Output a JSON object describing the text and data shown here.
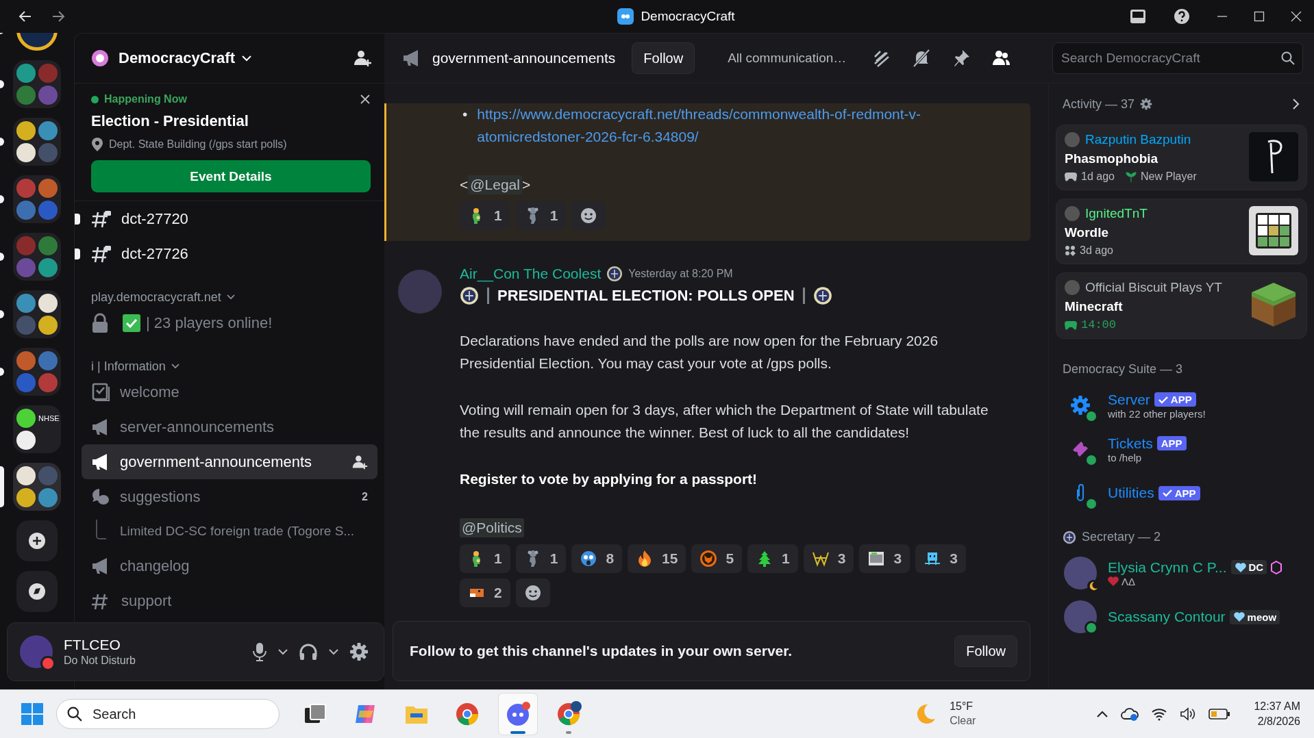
{
  "window": {
    "title": "DemocracyCraft"
  },
  "server_rail": [
    {
      "kind": "server",
      "unread": true,
      "selected": false
    },
    {
      "kind": "folder",
      "unread": true,
      "selected": false
    },
    {
      "kind": "folder",
      "unread": true,
      "selected": false
    },
    {
      "kind": "folder",
      "unread": true,
      "selected": false
    },
    {
      "kind": "folder",
      "unread": true,
      "selected": false
    },
    {
      "kind": "folder",
      "unread": true,
      "selected": false
    },
    {
      "kind": "folder",
      "unread": true,
      "selected": false
    },
    {
      "kind": "folder",
      "label": "NHSE",
      "unread": false,
      "selected": false
    },
    {
      "kind": "folder",
      "unread": false,
      "selected": true
    },
    {
      "kind": "add"
    },
    {
      "kind": "discover"
    }
  ],
  "sidebar": {
    "server_name": "DemocracyCraft",
    "event": {
      "status": "Happening Now",
      "title": "Election - Presidential",
      "location": "Dept. State Building (/gps start polls)",
      "button": "Event Details"
    },
    "items": [
      {
        "kind": "private-text",
        "name": "dct-27720",
        "unread": true,
        "selected": false
      },
      {
        "kind": "private-text",
        "name": "dct-27726",
        "unread": true,
        "selected": false
      },
      {
        "kind": "category",
        "name": "play.democracycraft.net"
      },
      {
        "kind": "locked-voice",
        "name": "| 23 players online!",
        "unread": false,
        "selected": false
      },
      {
        "kind": "category",
        "name": "i | Information"
      },
      {
        "kind": "rules",
        "name": "welcome",
        "unread": false,
        "selected": false
      },
      {
        "kind": "announcement",
        "name": "server-announcements",
        "unread": false,
        "selected": false
      },
      {
        "kind": "announcement",
        "name": "government-announcements",
        "unread": false,
        "selected": true
      },
      {
        "kind": "forum",
        "name": "suggestions",
        "badge": "2",
        "unread": false,
        "selected": false
      },
      {
        "kind": "thread",
        "name": "Limited DC-SC foreign trade (Togore S...",
        "unread": false,
        "selected": false
      },
      {
        "kind": "announcement",
        "name": "changelog",
        "unread": false,
        "selected": false
      },
      {
        "kind": "text",
        "name": "support",
        "unread": false,
        "selected": false
      }
    ],
    "user": {
      "name": "FTLCEO",
      "status": "Do Not Disturb"
    }
  },
  "header": {
    "channel": "government-announcements",
    "follow": "Follow",
    "notice": "All communication…",
    "tools": [
      {
        "kind": "threads",
        "selected": false
      },
      {
        "kind": "muted-bell",
        "selected": false
      },
      {
        "kind": "pin",
        "selected": false
      },
      {
        "kind": "members",
        "selected": true
      }
    ],
    "search": {
      "placeholder": "Search DemocracyCraft"
    }
  },
  "messages": [
    {
      "highlighted": true,
      "blocks": [
        {
          "kind": "link-list",
          "bullet": "•",
          "items": [
            "https://www.democracycraft.net/threads/commonwealth-of-redmont-v-atomicredstoner-2026-fcr-6.34809/"
          ]
        },
        {
          "kind": "mention-line",
          "before": "<",
          "mention": "@Legal",
          "after": ">"
        }
      ],
      "reactions": [
        {
          "kind": "person",
          "count": "1"
        },
        {
          "kind": "koala",
          "count": "1"
        }
      ]
    },
    {
      "highlighted": false,
      "author": "Air__Con The Coolest",
      "time": "Yesterday at 8:20 PM",
      "blocks": [
        {
          "kind": "heading",
          "text": "PRESIDENTIAL ELECTION: POLLS OPEN"
        },
        {
          "kind": "paragraph",
          "text": "Declarations have ended and the polls are now open for the February 2026 Presidential Election. You may cast your vote at /gps polls."
        },
        {
          "kind": "paragraph",
          "text": "Voting will remain open for 3 days, after which the Department of State will tabulate the results and announce the winner. Best of luck to all the candidates!"
        },
        {
          "kind": "bold-paragraph",
          "text": "Register to vote by applying for a passport!"
        },
        {
          "kind": "mention-line",
          "mention": "@Politics"
        }
      ],
      "reactions": [
        {
          "kind": "person",
          "count": "1"
        },
        {
          "kind": "koala",
          "count": "1"
        },
        {
          "kind": "fearful",
          "count": "8"
        },
        {
          "kind": "fire",
          "count": "15"
        },
        {
          "kind": "fox-badge",
          "count": "5"
        },
        {
          "kind": "tree",
          "count": "1"
        },
        {
          "kind": "crown",
          "count": "3"
        },
        {
          "kind": "wolf",
          "count": "3"
        },
        {
          "kind": "robot",
          "count": "3"
        },
        {
          "kind": "fox",
          "count": "2"
        }
      ]
    }
  ],
  "follow_banner": {
    "text": "Follow to get this channel's updates in your own server.",
    "button": "Follow"
  },
  "member_list": {
    "activity_header": "Activity — 37",
    "activities": [
      {
        "user": "Razputin Bazputin",
        "color": "#00a8fc",
        "game": "Phasmophobia",
        "thumb": {
          "kind": "phasmophobia"
        },
        "meta": [
          {
            "kind": "controller",
            "text": "1d ago"
          },
          {
            "kind": "sprout",
            "text": "New Player"
          }
        ]
      },
      {
        "user": "IgnitedTnT",
        "color": "#57f287",
        "game": "Wordle",
        "thumb": {
          "kind": "wordle"
        },
        "meta": [
          {
            "kind": "apps",
            "text": "3d ago"
          }
        ]
      },
      {
        "user": "Official Biscuit Plays YT",
        "color": "#b5bac1",
        "game": "Minecraft",
        "thumb": {
          "kind": "minecraft"
        },
        "meta": [
          {
            "kind": "timer",
            "text": "14:00"
          }
        ]
      }
    ],
    "groups": [
      {
        "title": "Democracy Suite — 3",
        "role_icon": false,
        "members": [
          {
            "name": "Server",
            "avatar": {
              "kind": "gear"
            },
            "presence": {
              "kind": "online"
            },
            "tag": {
              "kind": "app",
              "text": "APP",
              "verified": true
            },
            "subtitle": "with 22 other players!"
          },
          {
            "name": "Tickets",
            "avatar": {
              "kind": "ticket"
            },
            "presence": {
              "kind": "online"
            },
            "tag": {
              "kind": "app",
              "text": "APP",
              "verified": false
            },
            "subtitle": "to /help"
          },
          {
            "name": "Utilities",
            "avatar": {
              "kind": "clip"
            },
            "presence": {
              "kind": "online"
            },
            "tag": {
              "kind": "app",
              "text": "APP",
              "verified": true
            }
          }
        ]
      },
      {
        "title": "Secretary — 2",
        "role_icon": true,
        "members": [
          {
            "name": "Elysia Crynn C P...",
            "avatar": {
              "kind": "photo"
            },
            "presence": {
              "kind": "idle"
            },
            "tag": {
              "kind": "guild",
              "text": "DC"
            },
            "boosting": true,
            "subtitle": "ΛΔ",
            "subtitle_emoji": true
          },
          {
            "name": "Scassany Contour",
            "avatar": {
              "kind": "photo"
            },
            "presence": {
              "kind": "online"
            },
            "tag": {
              "kind": "guild",
              "text": "meow"
            }
          }
        ]
      }
    ]
  },
  "taskbar": {
    "search": {
      "placeholder": "Search"
    },
    "apps": [
      {
        "kind": "task-view",
        "active": false,
        "running": false
      },
      {
        "kind": "copilot",
        "active": false,
        "running": false
      },
      {
        "kind": "files",
        "active": false,
        "running": false
      },
      {
        "kind": "chrome",
        "active": false,
        "running": false
      },
      {
        "kind": "discord",
        "active": true,
        "running": true
      },
      {
        "kind": "chrome-profile",
        "active": false,
        "running": true
      }
    ],
    "weather": {
      "temp": "15°F",
      "condition": "Clear"
    },
    "clock": {
      "time": "12:37 AM",
      "date": "2/8/2026"
    }
  }
}
